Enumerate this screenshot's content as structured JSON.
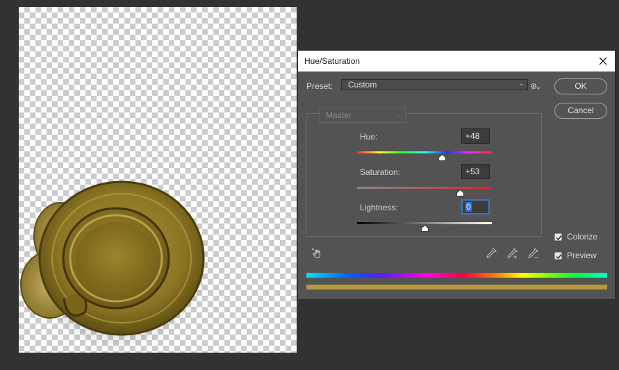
{
  "dialog": {
    "title": "Hue/Saturation",
    "preset_label": "Preset:",
    "preset_value": "Custom",
    "channel_value": "Master",
    "ok_label": "OK",
    "cancel_label": "Cancel"
  },
  "adjustments": [
    {
      "label": "Hue:",
      "value": "+48",
      "level": 48,
      "range": [
        -180,
        180
      ]
    },
    {
      "label": "Saturation:",
      "value": "+53",
      "level": 53,
      "range": [
        -100,
        100
      ]
    },
    {
      "label": "Lightness:",
      "value": "0",
      "level": 0,
      "range": [
        -100,
        100
      ]
    }
  ],
  "options": {
    "colorize_label": "Colorize",
    "colorize_checked": true,
    "preview_label": "Preview",
    "preview_checked": true
  },
  "icons": {
    "close": "close-icon",
    "settings": "gear-icon",
    "targeted_adjust": "hand-adjust-icon",
    "eyedropper": "eyedropper-icon",
    "add_to_sample": "eyedropper-plus-icon",
    "subtract_from_sample": "eyedropper-minus-icon"
  },
  "colors": {
    "canvas_background": "#323232",
    "dialog_background": "#535353",
    "focus_ring": "#3a76c4",
    "colorized_tone": "#b89a3a"
  }
}
